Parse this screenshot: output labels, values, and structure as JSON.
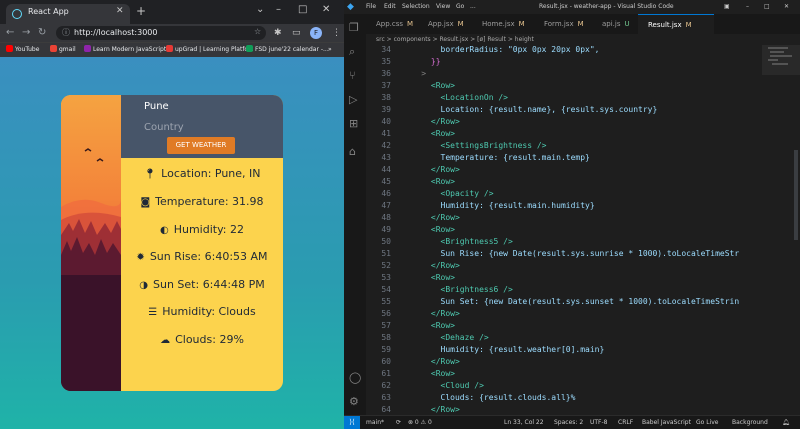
{
  "browser": {
    "tab_title": "React App",
    "url": "http://localhost:3000",
    "profile_initial": "F",
    "bookmarks": [
      {
        "label": "YouTube",
        "color": "#ff0000"
      },
      {
        "label": "gmail",
        "color": "#ea4335"
      },
      {
        "label": "Learn Modern JavaScript...",
        "color": "#8e24aa"
      },
      {
        "label": "upGrad | Learning Platfo...",
        "color": "#e53935"
      },
      {
        "label": "FSD june'22 calendar -...",
        "color": "#0f9d58"
      }
    ]
  },
  "weather_app": {
    "city_value": "Pune",
    "country_placeholder": "Country",
    "button_label": "GET WEATHER",
    "rows": [
      {
        "icon": "location-pin",
        "text": "Location: Pune, IN"
      },
      {
        "icon": "brightness",
        "text": "Temperature: 31.98"
      },
      {
        "icon": "opacity-drop",
        "text": "Humidity: 22"
      },
      {
        "icon": "brightness-5",
        "text": "Sun Rise: 6:40:53 AM"
      },
      {
        "icon": "brightness-6",
        "text": "Sun Set: 6:44:48 PM"
      },
      {
        "icon": "dehaze",
        "text": "Humidity: Clouds"
      },
      {
        "icon": "cloud",
        "text": "Clouds: 29%"
      }
    ]
  },
  "vscode": {
    "menu": [
      "File",
      "Edit",
      "Selection",
      "View",
      "Go",
      "..."
    ],
    "window_title": "Result.jsx - weather-app - Visual Studio Code",
    "tabs": [
      {
        "name": "App.css",
        "status": "M"
      },
      {
        "name": "App.jsx",
        "status": "M"
      },
      {
        "name": "Home.jsx",
        "status": "M"
      },
      {
        "name": "Form.jsx",
        "status": "M"
      },
      {
        "name": "api.js",
        "status": "U"
      },
      {
        "name": "Result.jsx",
        "status": "M"
      }
    ],
    "breadcrumbs": "src > components > Result.jsx > [ø] Result > height",
    "code_lines": [
      {
        "n": "34",
        "text": "        borderRadius: \"0px 0px 20px 0px\","
      },
      {
        "n": "35",
        "text": "      }}"
      },
      {
        "n": "36",
        "text": "    >"
      },
      {
        "n": "37",
        "text": "      <Row>"
      },
      {
        "n": "38",
        "text": "        <LocationOn />"
      },
      {
        "n": "39",
        "text": "        Location: {result.name}, {result.sys.country}"
      },
      {
        "n": "40",
        "text": "      </Row>"
      },
      {
        "n": "41",
        "text": "      <Row>"
      },
      {
        "n": "42",
        "text": "        <SettingsBrightness />"
      },
      {
        "n": "43",
        "text": "        Temperature: {result.main.temp}"
      },
      {
        "n": "44",
        "text": "      </Row>"
      },
      {
        "n": "45",
        "text": "      <Row>"
      },
      {
        "n": "46",
        "text": "        <Opacity />"
      },
      {
        "n": "47",
        "text": "        Humidity: {result.main.humidity}"
      },
      {
        "n": "48",
        "text": "      </Row>"
      },
      {
        "n": "49",
        "text": "      <Row>"
      },
      {
        "n": "50",
        "text": "        <Brightness5 />"
      },
      {
        "n": "51",
        "text": "        Sun Rise: {new Date(result.sys.sunrise * 1000).toLocaleTimeStr"
      },
      {
        "n": "52",
        "text": "      </Row>"
      },
      {
        "n": "53",
        "text": "      <Row>"
      },
      {
        "n": "54",
        "text": "        <Brightness6 />"
      },
      {
        "n": "55",
        "text": "        Sun Set: {new Date(result.sys.sunset * 1000).toLocaleTimeStrin"
      },
      {
        "n": "56",
        "text": "      </Row>"
      },
      {
        "n": "57",
        "text": "      <Row>"
      },
      {
        "n": "58",
        "text": "        <Dehaze />"
      },
      {
        "n": "59",
        "text": "        Humidity: {result.weather[0].main}"
      },
      {
        "n": "60",
        "text": "      </Row>"
      },
      {
        "n": "61",
        "text": "      <Row>"
      },
      {
        "n": "62",
        "text": "        <Cloud />"
      },
      {
        "n": "63",
        "text": "        Clouds: {result.clouds.all}%"
      },
      {
        "n": "64",
        "text": "      </Row>"
      }
    ],
    "status": {
      "branch": "main*",
      "position": "Ln 33, Col 22",
      "spaces": "Spaces: 2",
      "encoding": "UTF-8",
      "eol": "CRLF",
      "language": "Babel JavaScript",
      "golive": "Go Live",
      "background": "Background"
    }
  }
}
